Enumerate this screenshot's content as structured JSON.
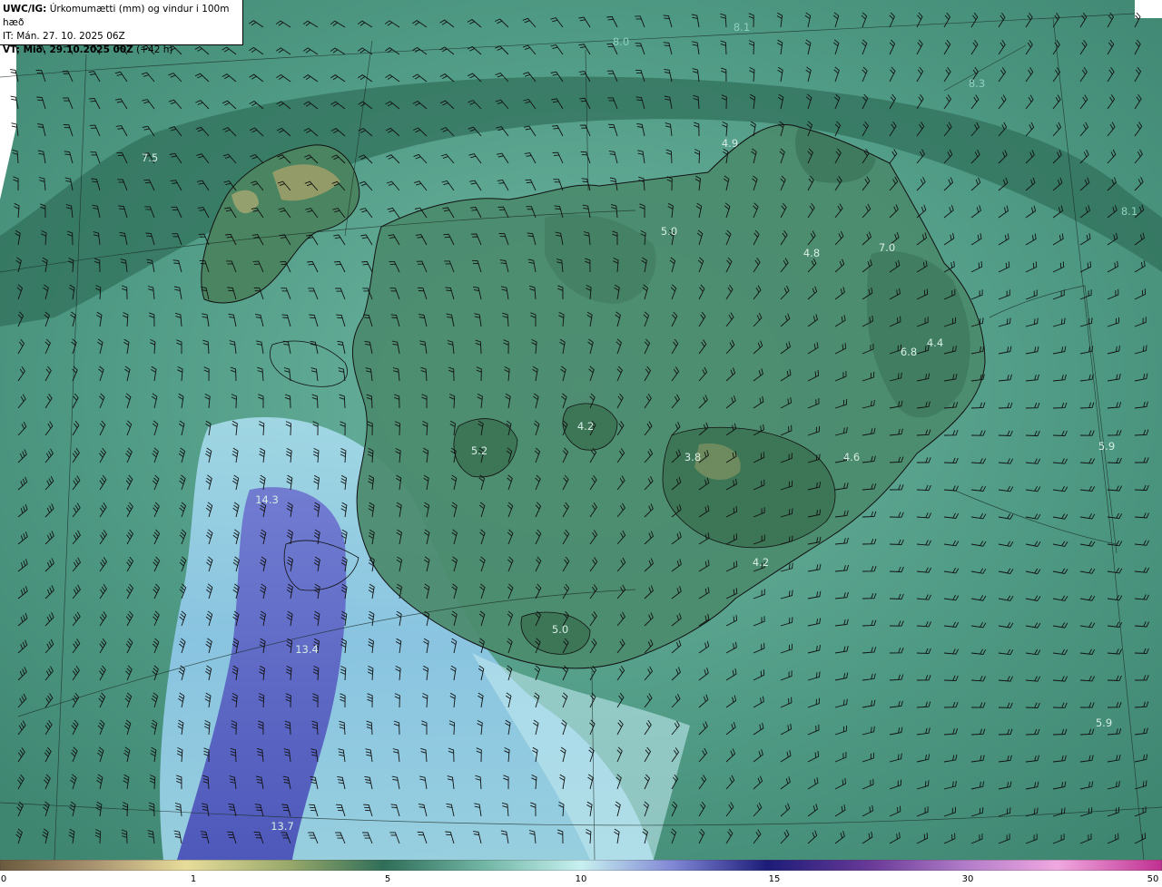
{
  "header": {
    "model": "UWC/IG:",
    "title": "Úrkomumætti (mm) og vindur i 100m hæð",
    "issue_time": "IT: Mán. 27. 10. 2025 06Z",
    "valid_prefix": "VT: Mið. 29.10.2025 00Z",
    "valid_offset": "(+42 h)"
  },
  "value_labels": [
    {
      "text": "8.1"
    },
    {
      "text": "8.0"
    },
    {
      "text": "8.3"
    },
    {
      "text": "7.5"
    },
    {
      "text": "4.9"
    },
    {
      "text": "5.0"
    },
    {
      "text": "4.8"
    },
    {
      "text": "7.0"
    },
    {
      "text": "8.1"
    },
    {
      "text": "4.4"
    },
    {
      "text": "6.8"
    },
    {
      "text": "4.2"
    },
    {
      "text": "5.2"
    },
    {
      "text": "3.8"
    },
    {
      "text": "4.6"
    },
    {
      "text": "5.9"
    },
    {
      "text": "14.3"
    },
    {
      "text": "4.2"
    },
    {
      "text": "5.0"
    },
    {
      "text": "13.4"
    },
    {
      "text": "5.9"
    },
    {
      "text": "13.7"
    }
  ],
  "legend": {
    "ticks": [
      "0",
      "1",
      "5",
      "10",
      "15",
      "30",
      "50"
    ],
    "colors": [
      "#6b5a3e",
      "#a89270",
      "#e8dc9a",
      "#97a86a",
      "#2f6e58",
      "#74b8a8",
      "#c8f0f0",
      "#7f86d4",
      "#1c1c78",
      "#b07cc8",
      "#f0a8e0",
      "#c03090"
    ]
  },
  "colors": {
    "sea": "#4f9a84",
    "land": "#3d7a5e",
    "precip_band": "#5aa6d8",
    "heavy_precip": "#4b55b8"
  }
}
